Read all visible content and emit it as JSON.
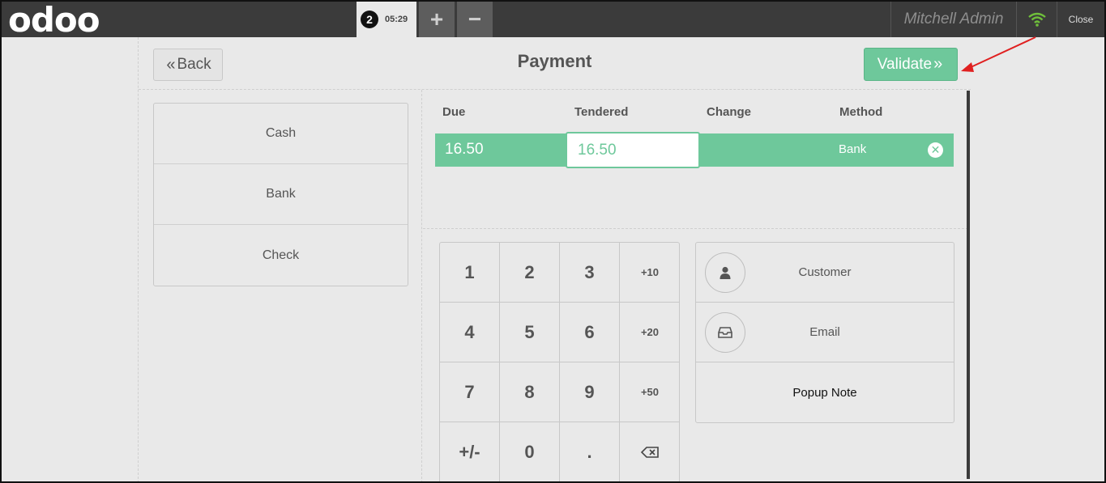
{
  "topbar": {
    "logo": "odoo",
    "order_number": "2",
    "order_time": "05:29",
    "add_order_label": "+",
    "remove_order_label": "−",
    "user_name": "Mitchell Admin",
    "close_label": "Close",
    "wifi_color": "#6fbf3b"
  },
  "header": {
    "back_label": "Back",
    "title": "Payment",
    "validate_label": "Validate"
  },
  "payment_methods": [
    "Cash",
    "Bank",
    "Check"
  ],
  "paymentlines": {
    "columns": [
      "Due",
      "Tendered",
      "Change",
      "Method"
    ],
    "line": {
      "due": "16.50",
      "tendered": "16.50",
      "change": "",
      "method": "Bank"
    }
  },
  "numpad": {
    "keys": [
      "1",
      "2",
      "3",
      "+10",
      "4",
      "5",
      "6",
      "+20",
      "7",
      "8",
      "9",
      "+50",
      "+/-",
      "0",
      ".",
      "backspace"
    ]
  },
  "extras": {
    "customer_label": "Customer",
    "email_label": "Email",
    "popup_note_label": "Popup Note"
  },
  "colors": {
    "accent": "#6ec89b",
    "topbar": "#3b3b3b",
    "background": "#e9e9e9",
    "annotation_arrow": "#e02020"
  }
}
